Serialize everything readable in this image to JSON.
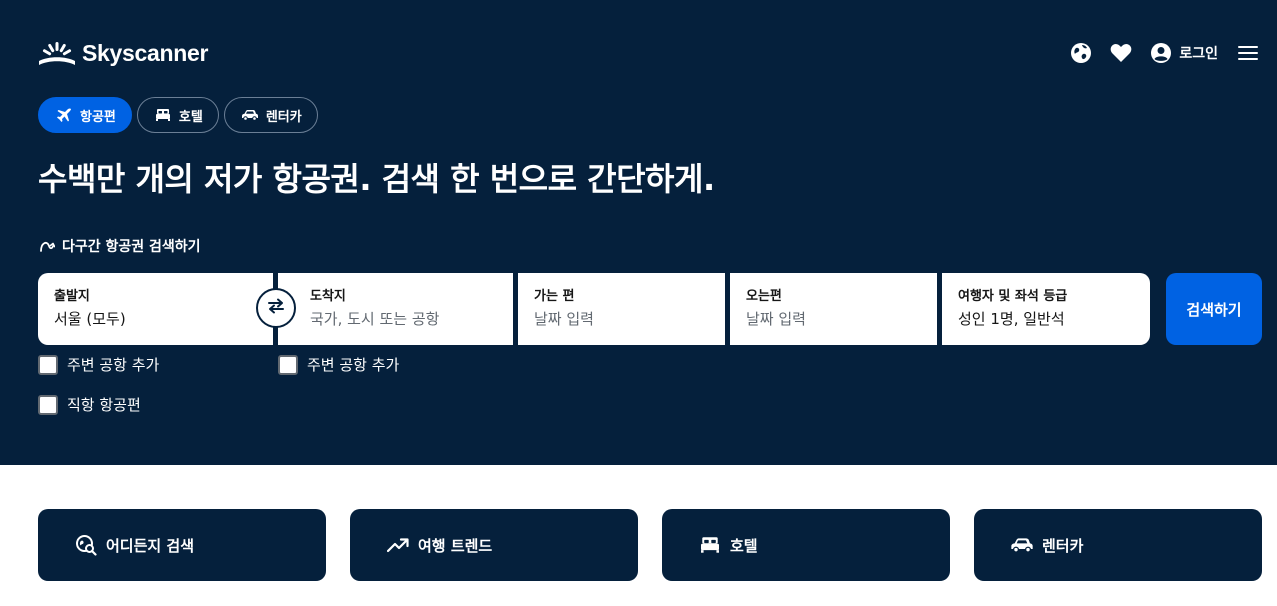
{
  "brand": {
    "name": "Skyscanner"
  },
  "header": {
    "login_label": "로그인"
  },
  "tabs": [
    {
      "label": "항공편",
      "icon": "plane-icon",
      "active": true
    },
    {
      "label": "호텔",
      "icon": "bed-icon",
      "active": false
    },
    {
      "label": "렌터카",
      "icon": "car-icon",
      "active": false
    }
  ],
  "headline": "수백만 개의 저가 항공권. 검색 한 번으로 간단하게.",
  "multi_city_label": "다구간 항공권 검색하기",
  "search": {
    "origin": {
      "label": "출발지",
      "value": "서울 (모두)"
    },
    "destination": {
      "label": "도착지",
      "placeholder": "국가, 도시 또는 공항"
    },
    "depart": {
      "label": "가는 편",
      "placeholder": "날짜 입력"
    },
    "return": {
      "label": "오는편",
      "placeholder": "날짜 입력"
    },
    "travellers": {
      "label": "여행자 및 좌석 등급",
      "value": "성인 1명, 일반석"
    },
    "button_label": "검색하기"
  },
  "checkboxes": {
    "origin_nearby": "주변 공항 추가",
    "dest_nearby": "주변 공항 추가",
    "direct_only": "직항 항공편"
  },
  "cards": [
    {
      "label": "어디든지 검색",
      "icon": "explore-icon"
    },
    {
      "label": "여행 트렌드",
      "icon": "trend-icon"
    },
    {
      "label": "호텔",
      "icon": "bed-icon"
    },
    {
      "label": "렌터카",
      "icon": "car-icon"
    }
  ],
  "colors": {
    "hero_bg": "#05203c",
    "accent": "#0062e3",
    "text_on_dark": "#ffffff"
  }
}
